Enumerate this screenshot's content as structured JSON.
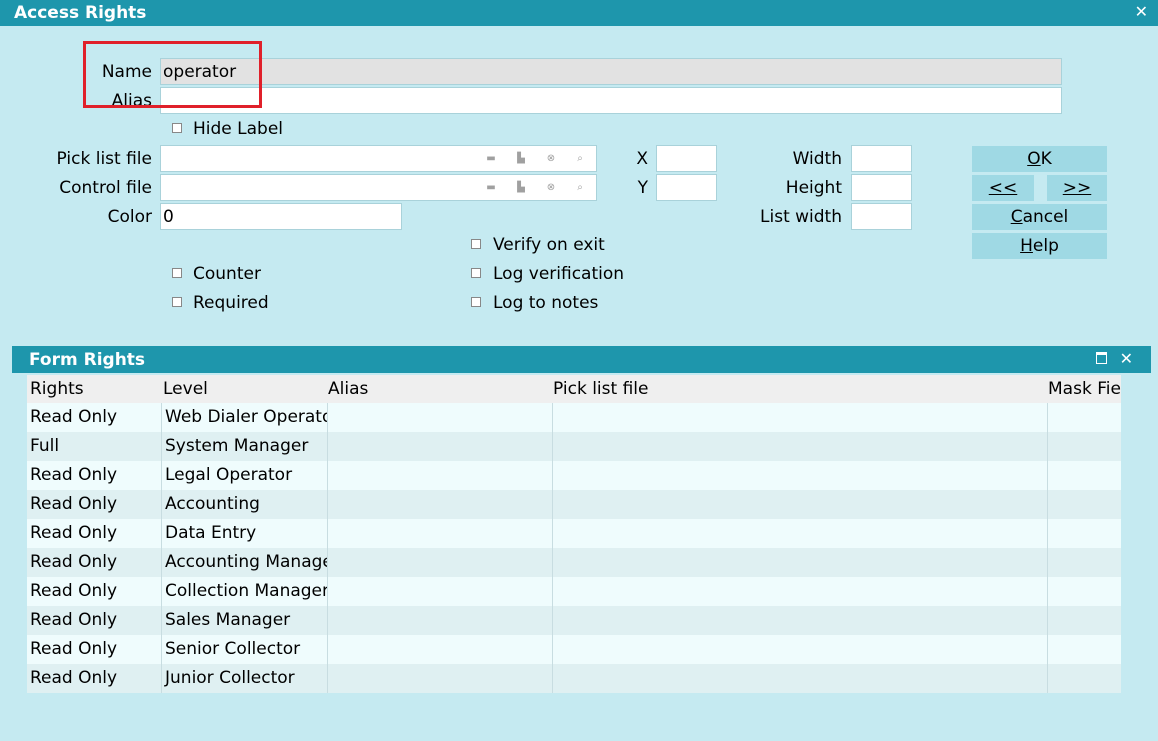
{
  "window": {
    "title": "Access Rights",
    "close_icon": "close-icon"
  },
  "form": {
    "name_label": "Name",
    "name_value": "operator",
    "alias_label": "Alias",
    "alias_value": "",
    "hide_label": "Hide Label",
    "pick_list_label": "Pick list file",
    "control_file_label": "Control file",
    "color_label": "Color",
    "color_value": "0",
    "x_label": "X",
    "y_label": "Y",
    "width_label": "Width",
    "height_label": "Height",
    "list_width_label": "List width",
    "counter_label": "Counter",
    "required_label": "Required",
    "verify_on_exit_label": "Verify on exit",
    "log_verification_label": "Log verification",
    "log_to_notes_label": "Log to notes"
  },
  "buttons": {
    "ok": {
      "mnemonic": "O",
      "rest": "K"
    },
    "prev": "<<",
    "next": ">>",
    "cancel": {
      "mnemonic": "C",
      "rest": "ancel"
    },
    "help": {
      "mnemonic": "H",
      "rest": "elp"
    }
  },
  "panel": {
    "title": "Form Rights",
    "columns": [
      "Rights",
      "Level",
      "Alias",
      "Pick list file",
      "Mask Fie"
    ],
    "rows": [
      {
        "rights": "Read Only",
        "level": "Web Dialer Operator"
      },
      {
        "rights": "Full",
        "level": "System Manager"
      },
      {
        "rights": "Read Only",
        "level": "Legal Operator"
      },
      {
        "rights": "Read Only",
        "level": "Accounting"
      },
      {
        "rights": "Read Only",
        "level": "Data Entry"
      },
      {
        "rights": "Read Only",
        "level": "Accounting Manager"
      },
      {
        "rights": "Read Only",
        "level": "Collection Manager"
      },
      {
        "rights": "Read Only",
        "level": "Sales Manager"
      },
      {
        "rights": "Read Only",
        "level": "Senior Collector"
      },
      {
        "rights": "Read Only",
        "level": "Junior Collector"
      }
    ]
  }
}
